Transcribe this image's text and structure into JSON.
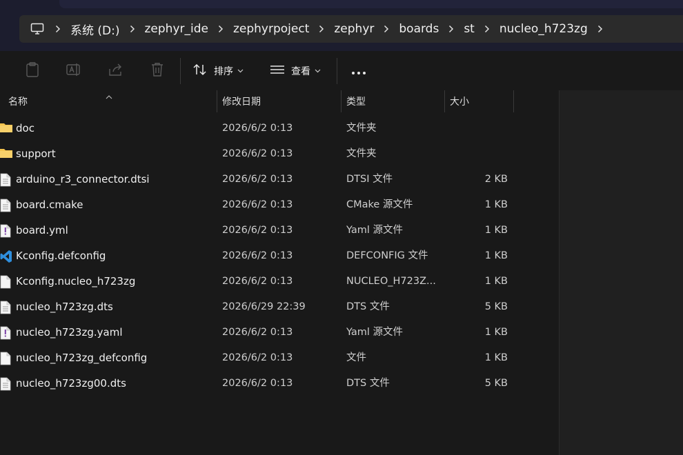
{
  "breadcrumb": {
    "items": [
      "系统 (D:)",
      "zephyr_ide",
      "zephyrpoject",
      "zephyr",
      "boards",
      "st",
      "nucleo_h723zg"
    ]
  },
  "toolbar": {
    "sort_label": "排序",
    "view_label": "查看"
  },
  "columns": {
    "name": "名称",
    "date": "修改日期",
    "type": "类型",
    "size": "大小"
  },
  "files": [
    {
      "name": "doc",
      "date": "2026/6/2 0:13",
      "type": "文件夹",
      "size": "",
      "icon": "folder-icon"
    },
    {
      "name": "support",
      "date": "2026/6/2 0:13",
      "type": "文件夹",
      "size": "",
      "icon": "folder-icon"
    },
    {
      "name": "arduino_r3_connector.dtsi",
      "date": "2026/6/2 0:13",
      "type": "DTSI 文件",
      "size": "2 KB",
      "icon": "text-file-icon"
    },
    {
      "name": "board.cmake",
      "date": "2026/6/2 0:13",
      "type": "CMake 源文件",
      "size": "1 KB",
      "icon": "text-file-icon"
    },
    {
      "name": "board.yml",
      "date": "2026/6/2 0:13",
      "type": "Yaml 源文件",
      "size": "1 KB",
      "icon": "yaml-file-icon"
    },
    {
      "name": "Kconfig.defconfig",
      "date": "2026/6/2 0:13",
      "type": "DEFCONFIG 文件",
      "size": "1 KB",
      "icon": "vscode-file-icon"
    },
    {
      "name": "Kconfig.nucleo_h723zg",
      "date": "2026/6/2 0:13",
      "type": "NUCLEO_H723Z...",
      "size": "1 KB",
      "icon": "blank-file-icon"
    },
    {
      "name": "nucleo_h723zg.dts",
      "date": "2026/6/29 22:39",
      "type": "DTS 文件",
      "size": "5 KB",
      "icon": "text-file-icon"
    },
    {
      "name": "nucleo_h723zg.yaml",
      "date": "2026/6/2 0:13",
      "type": "Yaml 源文件",
      "size": "1 KB",
      "icon": "yaml-file-icon"
    },
    {
      "name": "nucleo_h723zg_defconfig",
      "date": "2026/6/2 0:13",
      "type": "文件",
      "size": "1 KB",
      "icon": "blank-file-icon"
    },
    {
      "name": "nucleo_h723zg00.dts",
      "date": "2026/6/2 0:13",
      "type": "DTS 文件",
      "size": "5 KB",
      "icon": "text-file-icon"
    }
  ],
  "colors": {
    "background": "#191919",
    "folder": "#f4c44e",
    "vscode": "#2f8fde",
    "yaml_mark": "#7a3fa6"
  }
}
